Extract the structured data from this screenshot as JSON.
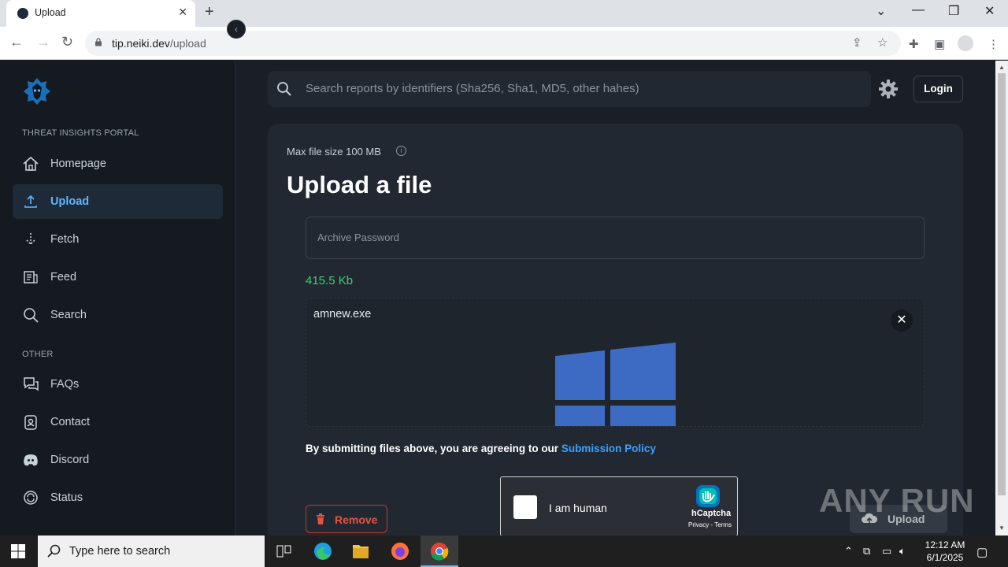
{
  "browser": {
    "tab_title": "Upload",
    "url_host": "tip.neiki.dev",
    "url_path": "/upload"
  },
  "sidebar": {
    "section_main": "THREAT INSIGHTS PORTAL",
    "items": [
      {
        "label": "Homepage",
        "icon": "home-icon"
      },
      {
        "label": "Upload",
        "icon": "upload-icon",
        "active": true
      },
      {
        "label": "Fetch",
        "icon": "fetch-icon"
      },
      {
        "label": "Feed",
        "icon": "feed-icon"
      },
      {
        "label": "Search",
        "icon": "search-icon"
      }
    ],
    "section_other": "OTHER",
    "other_items": [
      {
        "label": "FAQs",
        "icon": "faq-icon"
      },
      {
        "label": "Contact",
        "icon": "contact-icon"
      },
      {
        "label": "Discord",
        "icon": "discord-icon"
      },
      {
        "label": "Status",
        "icon": "status-icon"
      }
    ]
  },
  "header": {
    "search_placeholder": "Search reports by identifiers (Sha256, Sha1, MD5, other hahes)",
    "login_label": "Login"
  },
  "upload": {
    "max_size": "Max file size 100 MB",
    "title": "Upload a file",
    "password_placeholder": "Archive Password",
    "file_size": "415.5 Kb",
    "file_name": "amnew.exe",
    "agree_text": "By submitting files above, you are agreeing to our ",
    "policy_link": "Submission Policy",
    "remove_label": "Remove",
    "upload_label": "Upload"
  },
  "captcha": {
    "label": "I am human",
    "brand": "hCaptcha",
    "links": "Privacy - Terms"
  },
  "watermark": "ANY RUN",
  "taskbar": {
    "search_placeholder": "Type here to search",
    "time": "12:12 AM",
    "date": "6/1/2025"
  },
  "colors": {
    "accent": "#3aa0ff",
    "file_size": "#3fcf6b",
    "remove": "#e8533f",
    "windows_logo": "#3d6bc4"
  }
}
